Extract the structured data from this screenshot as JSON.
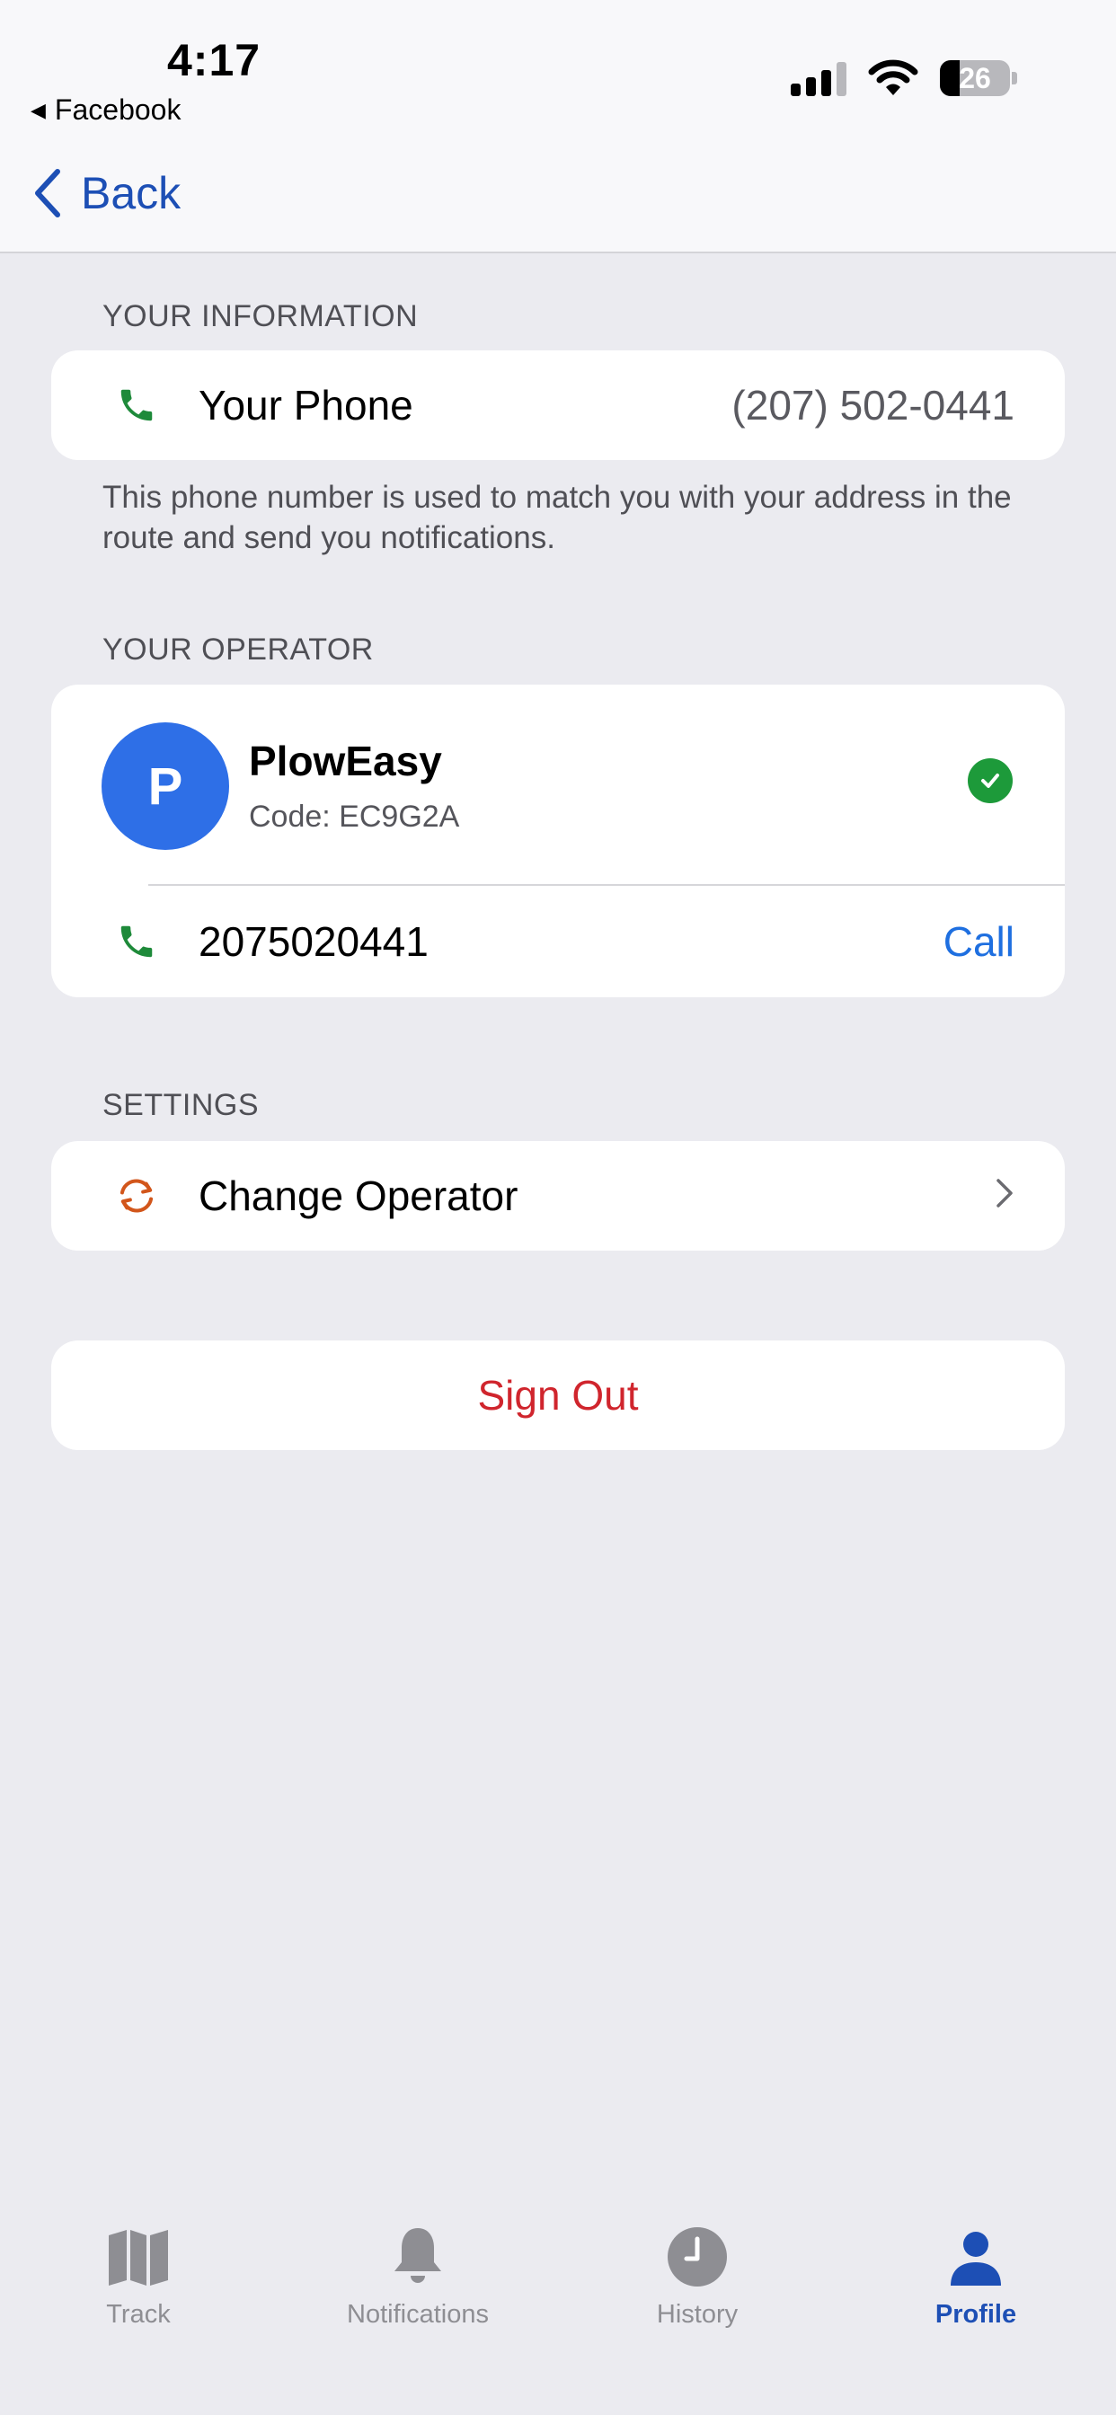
{
  "status_bar": {
    "time": "4:17",
    "back_app": "Facebook",
    "battery": "26"
  },
  "nav": {
    "back_label": "Back"
  },
  "your_information": {
    "header": "YOUR INFORMATION",
    "phone_label": "Your Phone",
    "phone_value": "(207) 502-0441",
    "footnote": "This phone number is used to match you with your address in the route and send you notifications."
  },
  "your_operator": {
    "header": "YOUR OPERATOR",
    "avatar_initial": "P",
    "name": "PlowEasy",
    "code": "Code: EC9G2A",
    "phone": "2075020441",
    "call_label": "Call"
  },
  "settings": {
    "header": "SETTINGS",
    "change_operator_label": "Change Operator"
  },
  "sign_out_label": "Sign Out",
  "tabs": [
    {
      "label": "Track",
      "icon": "map-icon"
    },
    {
      "label": "Notifications",
      "icon": "bell-icon"
    },
    {
      "label": "History",
      "icon": "clock-icon"
    },
    {
      "label": "Profile",
      "icon": "person-icon"
    }
  ],
  "colors": {
    "accent": "#1D4FB5",
    "link": "#1E6FE0",
    "phone_icon": "#1E8A3A",
    "verified": "#1D9A3A",
    "destructive": "#D0252D",
    "change_icon": "#D2561B",
    "avatar": "#2E6FE7"
  }
}
